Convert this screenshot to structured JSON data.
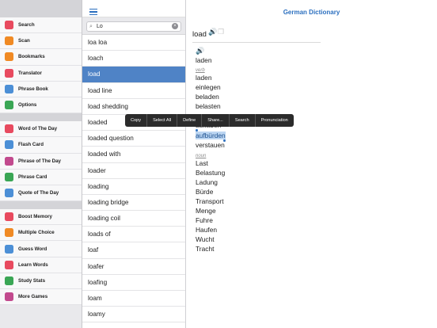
{
  "app": {
    "title": "German Dictionary"
  },
  "sidebar": {
    "groups": [
      {
        "items": [
          {
            "label": "Search",
            "icon": "search-icon",
            "color": "#e84a5f"
          },
          {
            "label": "Scan",
            "icon": "scan-icon",
            "color": "#f08a24"
          },
          {
            "label": "Bookmarks",
            "icon": "bookmarks-icon",
            "color": "#f08a24"
          },
          {
            "label": "Translator",
            "icon": "translator-icon",
            "color": "#e84a5f"
          },
          {
            "label": "Phrase Book",
            "icon": "phrase-book-icon",
            "color": "#4c8fd6"
          },
          {
            "label": "Options",
            "icon": "gear-icon",
            "color": "#3aa655"
          }
        ]
      },
      {
        "items": [
          {
            "label": "Word of The Day",
            "icon": "word-of-day-icon",
            "color": "#e84a5f"
          },
          {
            "label": "Flash Card",
            "icon": "flash-card-icon",
            "color": "#4c8fd6"
          },
          {
            "label": "Phrase of The Day",
            "icon": "phrase-of-day-icon",
            "color": "#c24a8e"
          },
          {
            "label": "Phrase Card",
            "icon": "phrase-card-icon",
            "color": "#3aa655"
          },
          {
            "label": "Quote of The Day",
            "icon": "quote-icon",
            "color": "#4c8fd6"
          }
        ]
      },
      {
        "items": [
          {
            "label": "Boost Memory",
            "icon": "boost-memory-icon",
            "color": "#e84a5f"
          },
          {
            "label": "Multiple Choice",
            "icon": "multiple-choice-icon",
            "color": "#f08a24"
          },
          {
            "label": "Guess Word",
            "icon": "guess-word-icon",
            "color": "#4c8fd6"
          },
          {
            "label": "Learn Words",
            "icon": "learn-words-icon",
            "color": "#e84a5f"
          },
          {
            "label": "Study Stats",
            "icon": "study-stats-icon",
            "color": "#3aa655"
          },
          {
            "label": "More Games",
            "icon": "more-games-icon",
            "color": "#c24a8e"
          }
        ]
      }
    ]
  },
  "search": {
    "value": "Lo"
  },
  "word_list": {
    "selected_index": 2,
    "items": [
      "loa loa",
      "loach",
      "load",
      "load line",
      "load shedding",
      "loaded",
      "loaded question",
      "loaded with",
      "loader",
      "loading",
      "loading bridge",
      "loading coil",
      "loads of",
      "loaf",
      "loafer",
      "loafing",
      "loam",
      "loamy"
    ]
  },
  "entry": {
    "headword": "load",
    "top_translation": "laden",
    "verb_label": "verb",
    "verb_translations": [
      "laden",
      "einlegen",
      "beladen",
      "belasten",
      "aufladen"
    ],
    "selected_word": "aufbürden",
    "after_selected": "verstauen",
    "noun_label": "noun",
    "noun_translations": [
      "Last",
      "Belastung",
      "Ladung",
      "Bürde",
      "Transport",
      "Menge",
      "Fuhre",
      "Haufen",
      "Wucht",
      "Tracht"
    ]
  },
  "context_menu": [
    "Copy",
    "Select All",
    "Define",
    "Share...",
    "Search",
    "Pronunciation"
  ]
}
